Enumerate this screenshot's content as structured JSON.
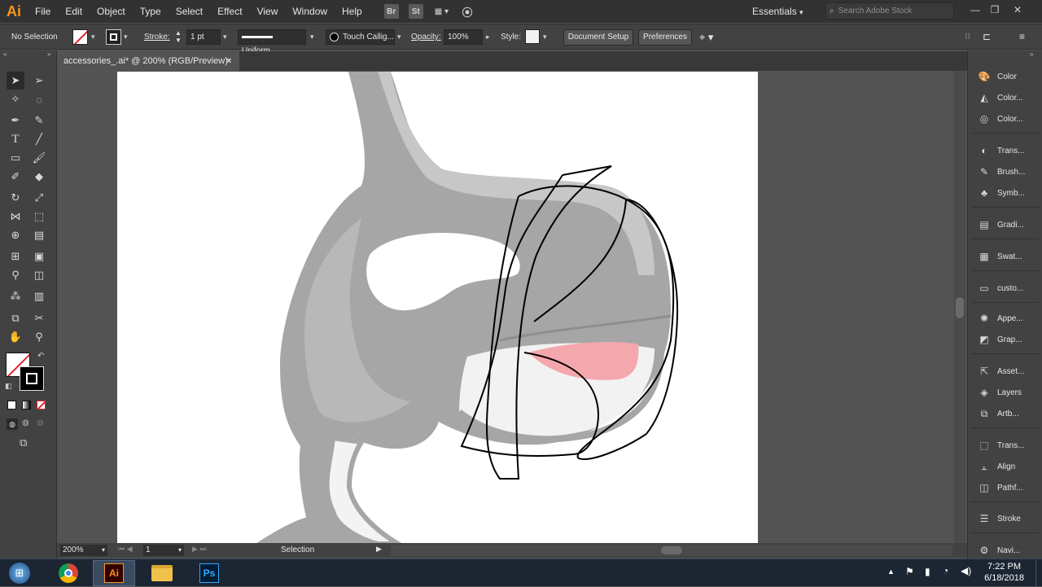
{
  "app": {
    "logo": "Ai",
    "menus": [
      "File",
      "Edit",
      "Object",
      "Type",
      "Select",
      "Effect",
      "View",
      "Window",
      "Help"
    ],
    "bridge_label": "Br",
    "stock_label": "St",
    "workspace": "Essentials",
    "search_placeholder": "Search Adobe Stock"
  },
  "control_bar": {
    "selection_status": "No Selection",
    "stroke_label": "Stroke:",
    "stroke_weight": "1 pt",
    "profile_label": "Uniform",
    "brush_label": "Touch Callig...",
    "opacity_label": "Opacity:",
    "opacity_value": "100%",
    "style_label": "Style:",
    "document_setup": "Document Setup",
    "preferences": "Preferences"
  },
  "document": {
    "tab_title": "accessories_.ai* @ 200% (RGB/Preview)",
    "close_glyph": "×"
  },
  "status_bar": {
    "zoom": "200%",
    "artboard": "1",
    "tool": "Selection"
  },
  "panels": [
    {
      "icon": "color-icon",
      "label": "Color"
    },
    {
      "icon": "color-guide-icon",
      "label": "Color..."
    },
    {
      "icon": "color-themes-icon",
      "label": "Color..."
    },
    {
      "icon": "transparency-icon",
      "label": "Trans..."
    },
    {
      "icon": "brushes-icon",
      "label": "Brush..."
    },
    {
      "icon": "symbols-icon",
      "label": "Symb..."
    },
    {
      "icon": "gradient-icon",
      "label": "Gradi..."
    },
    {
      "icon": "swatches-icon",
      "label": "Swat..."
    },
    {
      "icon": "custom-library-icon",
      "label": "custo..."
    },
    {
      "icon": "appearance-icon",
      "label": "Appe..."
    },
    {
      "icon": "graphic-styles-icon",
      "label": "Grap..."
    },
    {
      "icon": "asset-export-icon",
      "label": "Asset..."
    },
    {
      "icon": "layers-icon",
      "label": "Layers"
    },
    {
      "icon": "artboards-icon",
      "label": "Artb..."
    },
    {
      "icon": "transform-icon",
      "label": "Trans..."
    },
    {
      "icon": "align-icon",
      "label": "Align"
    },
    {
      "icon": "pathfinder-icon",
      "label": "Pathf..."
    },
    {
      "icon": "stroke-icon",
      "label": "Stroke"
    },
    {
      "icon": "navigator-icon",
      "label": "Navi..."
    }
  ],
  "taskbar": {
    "time": "7:22 PM",
    "date": "6/18/2018",
    "apps": [
      "chrome",
      "illustrator",
      "file-explorer",
      "photoshop"
    ],
    "ai_label": "Ai",
    "ps_label": "Ps"
  },
  "colors": {
    "ui_dark": "#323232",
    "ui_panel": "#424242",
    "canvas_bg": "#535353",
    "ai_orange": "#f7941d",
    "whale_gray": "#a3a3a3",
    "tongue_pink": "#f4a7ac"
  }
}
